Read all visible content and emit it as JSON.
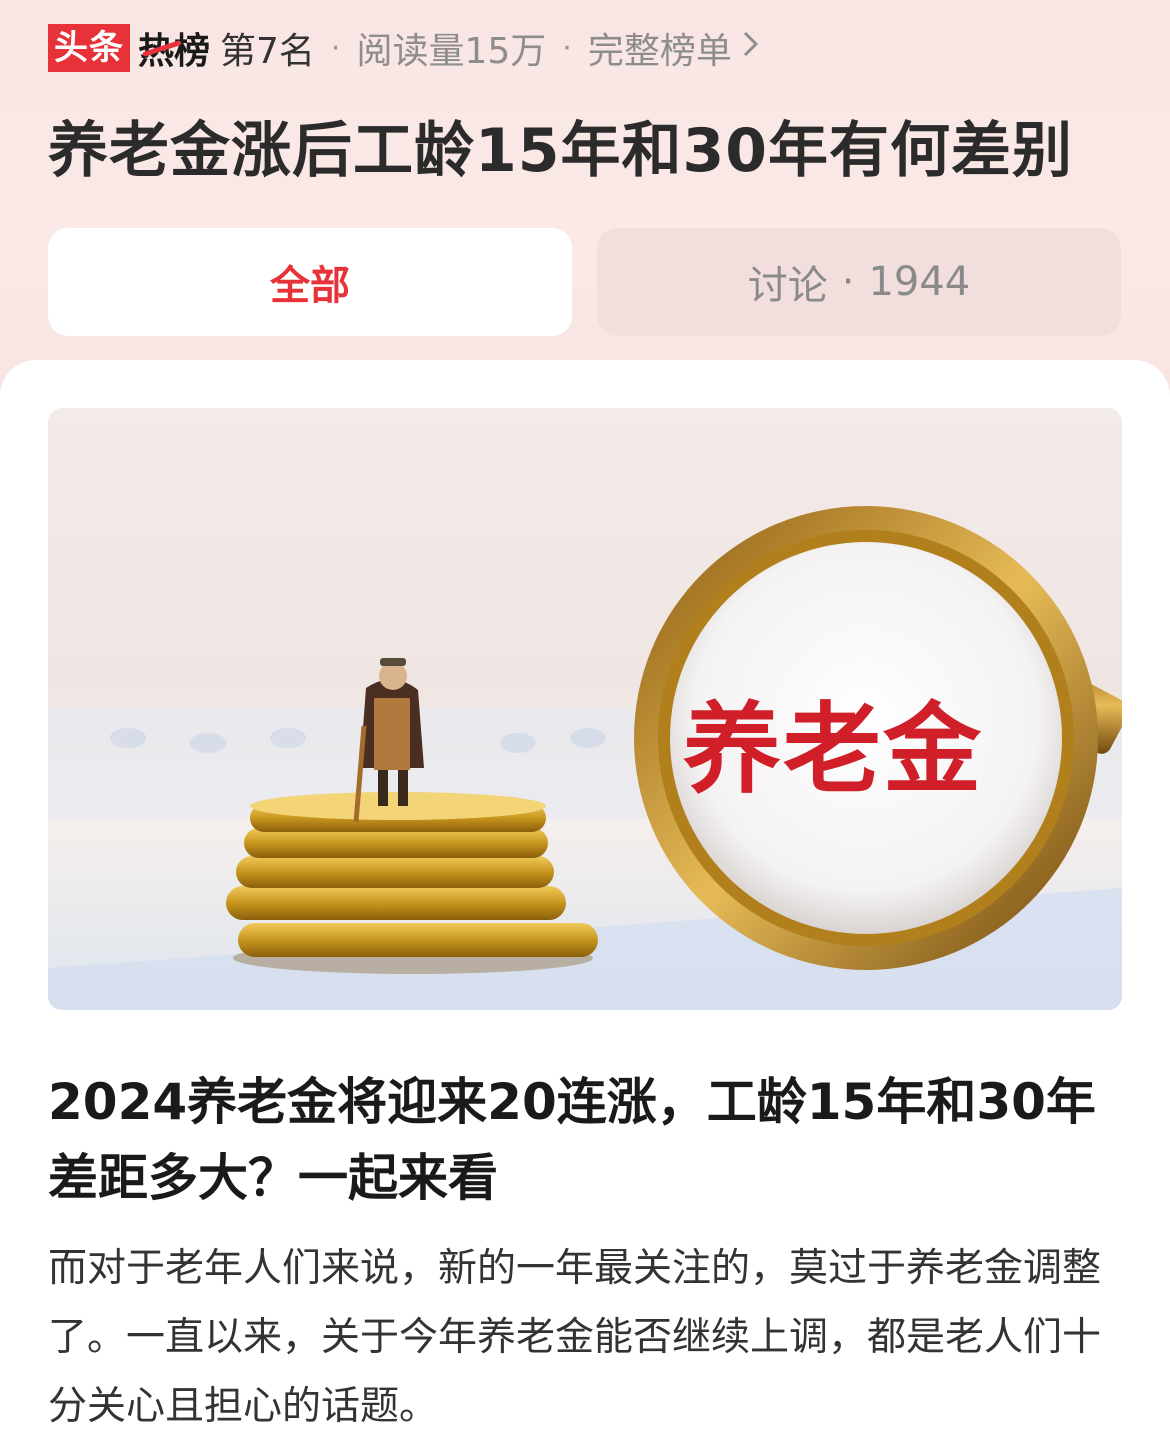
{
  "header": {
    "brand_badge": "头条",
    "brand_hot": "热榜",
    "rank": "第7名",
    "separator": "·",
    "reads": "阅读量15万",
    "full_list": "完整榜单",
    "chevron_icon": "chevron-right-icon"
  },
  "topic": {
    "title": "养老金涨后工龄15年和30年有何差别"
  },
  "tabs": {
    "all_label": "全部",
    "discuss_label": "讨论",
    "discuss_separator": "·",
    "discuss_count": "1944"
  },
  "article": {
    "image_text": "养老金",
    "title": "2024养老金将迎来20连涨，工龄15年和30年差距多大？一起来看",
    "body": "而对于老年人们来说，新的一年最关注的，莫过于养老金调整了。一直以来，关于今年养老金能否继续上调，都是老人们十分关心且担心的话题。"
  },
  "colors": {
    "accent": "#e8323a",
    "header_bg": "#f9e6e4",
    "muted_text": "#8d8d8d"
  }
}
